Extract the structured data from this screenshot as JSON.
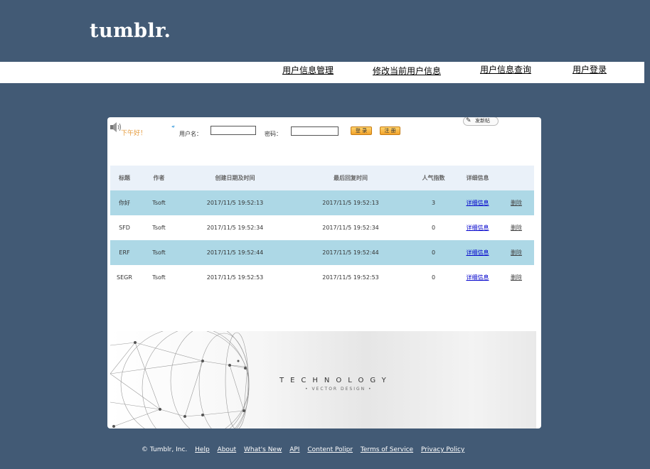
{
  "brand": {
    "logo": "tumblr."
  },
  "nav": {
    "items": [
      {
        "label": "用户信息管理"
      },
      {
        "label": "修改当前用户信息"
      },
      {
        "label": "用户信息查询"
      },
      {
        "label": "用户登录"
      }
    ]
  },
  "login": {
    "greeting": "下午好！",
    "username_label": "用户名：",
    "username_value": "",
    "password_label": "密码：",
    "password_value": "",
    "login_button": "登 录",
    "register_button": "注 册",
    "post_button": "发新帖"
  },
  "table": {
    "headers": [
      "标题",
      "作者",
      "创建日期及时间",
      "最后回复时间",
      "人气指数",
      "详细信息"
    ],
    "detail_link": "详细信息",
    "delete_link": "删除",
    "rows": [
      {
        "title": "你好",
        "author": "Tsoft",
        "created": "2017/11/5 19:52:13",
        "last_reply": "2017/11/5 19:52:13",
        "popularity": "3"
      },
      {
        "title": "SFD",
        "author": "Tsoft",
        "created": "2017/11/5 19:52:34",
        "last_reply": "2017/11/5 19:52:34",
        "popularity": "0"
      },
      {
        "title": "ERF",
        "author": "Tsoft",
        "created": "2017/11/5 19:52:44",
        "last_reply": "2017/11/5 19:52:44",
        "popularity": "0"
      },
      {
        "title": "SEGR",
        "author": "Tsoft",
        "created": "2017/11/5 19:52:53",
        "last_reply": "2017/11/5 19:52:53",
        "popularity": "0"
      }
    ]
  },
  "banner": {
    "title": "TECHNOLOGY",
    "subtitle": "• VECTOR DESIGN •"
  },
  "footer": {
    "copyright": "© Tumblr, Inc.",
    "links": [
      "Help",
      "About",
      "What's New",
      "API",
      "Content Polipr",
      "Terms of Service",
      "Privacy Policy"
    ]
  },
  "colors": {
    "page_bg": "#425a75",
    "row_highlight": "#add8e6",
    "header_bg": "#eaf1f9",
    "link_blue": "#0000cc",
    "greeting_orange": "#e59b3c"
  }
}
